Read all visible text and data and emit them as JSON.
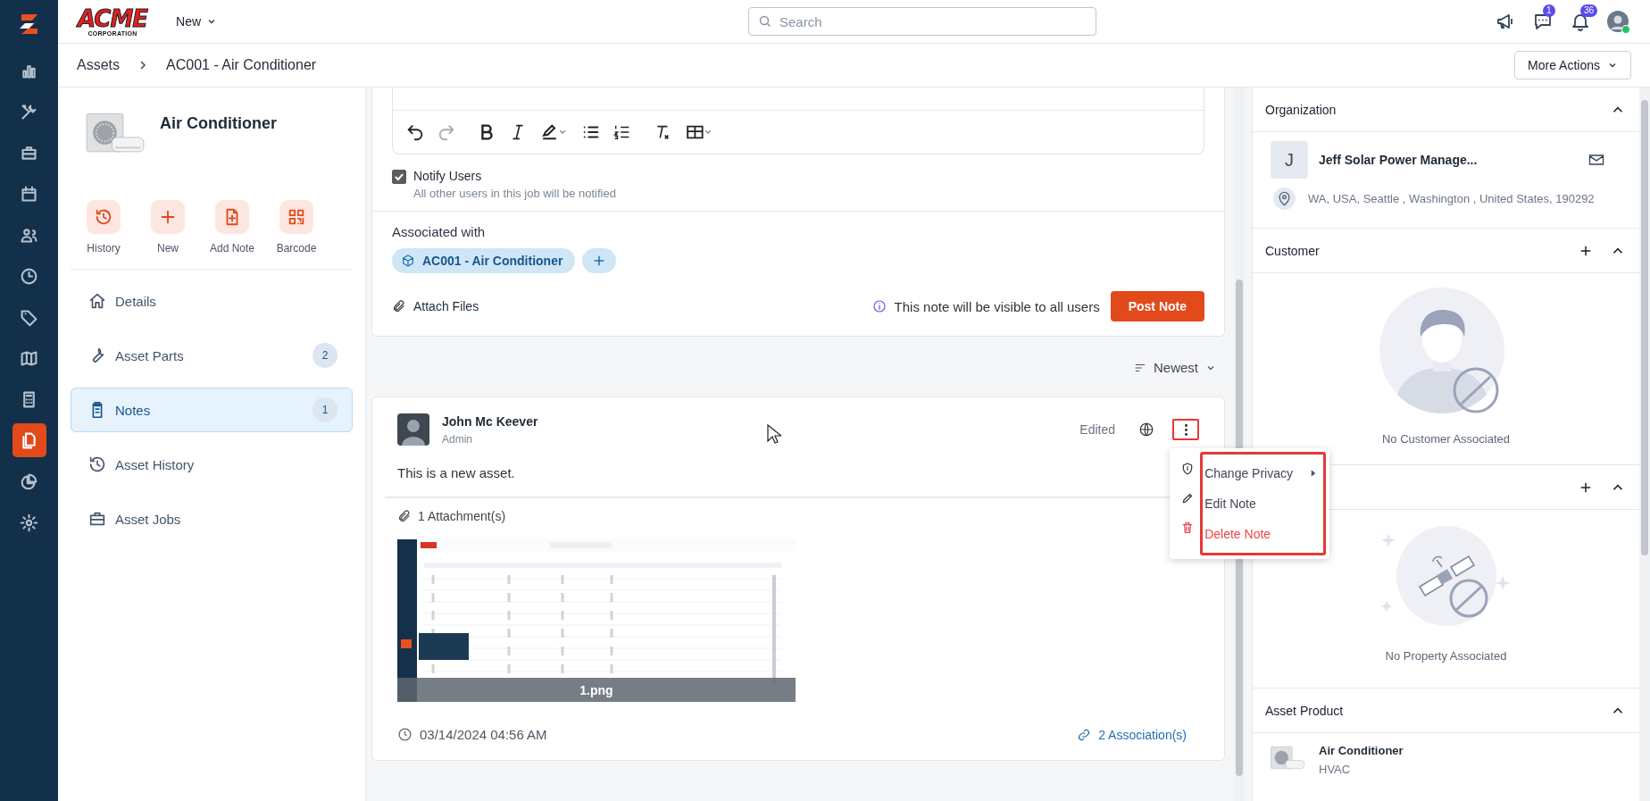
{
  "logo": {
    "name": "ACME",
    "tagline": "CORPORATION"
  },
  "app_bar": {
    "new_menu": "New",
    "search": {
      "placeholder": "Search"
    },
    "chat_badge": "1",
    "notification_badge": "36"
  },
  "nav_items": [
    {
      "kind": "chart",
      "selected": false
    },
    {
      "kind": "tools",
      "selected": false
    },
    {
      "kind": "briefcase",
      "selected": false
    },
    {
      "kind": "calendar",
      "selected": false
    },
    {
      "kind": "users",
      "selected": false
    },
    {
      "kind": "clock",
      "selected": false
    },
    {
      "kind": "tag",
      "selected": false
    },
    {
      "kind": "map",
      "selected": false
    },
    {
      "kind": "calculator",
      "selected": false
    },
    {
      "kind": "documents",
      "selected": true
    },
    {
      "kind": "pie",
      "selected": false
    },
    {
      "kind": "gear",
      "selected": false
    }
  ],
  "breadcrumb": [
    "Assets",
    "AC001 - Air Conditioner"
  ],
  "more_actions": "More Actions",
  "asset": {
    "name": "Air Conditioner",
    "actions": [
      {
        "kind": "history",
        "label": "History"
      },
      {
        "kind": "new",
        "label": "New"
      },
      {
        "kind": "note",
        "label": "Add Note"
      },
      {
        "kind": "barcode",
        "label": "Barcode"
      }
    ],
    "menu": [
      {
        "kind": "details",
        "label": "Details",
        "selected": false
      },
      {
        "kind": "parts",
        "label": "Asset Parts",
        "count": "2",
        "selected": false
      },
      {
        "kind": "notes",
        "label": "Notes",
        "count": "1",
        "selected": true
      },
      {
        "kind": "history",
        "label": "Asset History",
        "selected": false
      },
      {
        "kind": "jobs",
        "label": "Asset Jobs",
        "selected": false
      }
    ]
  },
  "composer": {
    "notify": {
      "label": "Notify Users",
      "hint": "All other users in this job will be notified",
      "checked": true
    },
    "associated_label": "Associated with",
    "association_chip": "AC001 - Air Conditioner",
    "attach": "Attach Files",
    "visibility_info": "This note will be visible to all users",
    "post": "Post Note"
  },
  "sort": "Newest",
  "note": {
    "author": "John Mc Keever",
    "role": "Admin",
    "status": "Edited",
    "body": "This is a new asset.",
    "attachments_label": "1 Attachment(s)",
    "attachment": {
      "kind": "picture",
      "filename": "1.png"
    },
    "timestamp": "03/14/2024 04:56 AM",
    "associations": "2 Association(s)"
  },
  "note_menu": [
    {
      "kind": "privacy",
      "label": "Change Privacy",
      "danger": false,
      "submenu": true
    },
    {
      "kind": "edit",
      "label": "Edit Note",
      "danger": false,
      "submenu": false
    },
    {
      "kind": "delete",
      "label": "Delete Note",
      "danger": true,
      "submenu": false
    }
  ],
  "right": {
    "organization": {
      "title": "Organization",
      "expanded": true,
      "initial": "J",
      "name": "Jeff Solar Power Manage...",
      "address": "WA, USA, Seattle , Washington , United States, 190292"
    },
    "customer": {
      "title": "Customer",
      "expanded": true,
      "empty": "No Customer Associated"
    },
    "property": {
      "expanded": true,
      "empty": "No Property Associated"
    },
    "asset_product": {
      "title": "Asset Product",
      "expanded": true,
      "name": "Air Conditioner",
      "category": "HVAC"
    }
  }
}
